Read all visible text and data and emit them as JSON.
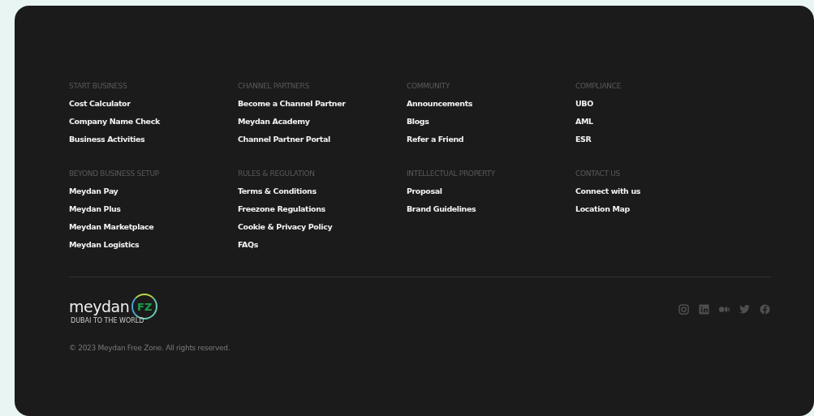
{
  "footer": {
    "columns": [
      {
        "sections": [
          {
            "heading": "START BUSINESS",
            "links": [
              "Cost Calculator",
              "Company Name Check",
              "Business Activities"
            ]
          },
          {
            "heading": "BEYOND BUSINESS SETUP",
            "links": [
              "Meydan Pay",
              "Meydan Plus",
              "Meydan Marketplace",
              "Meydan Logistics"
            ]
          }
        ]
      },
      {
        "sections": [
          {
            "heading": "CHANNEL PARTNERS",
            "links": [
              "Become a Channel Partner",
              "Meydan Academy",
              "Channel Partner Portal"
            ]
          },
          {
            "heading": "RULES & REGULATION",
            "links": [
              "Terms & Conditions",
              "Freezone Regulations",
              "Cookie & Privacy Policy",
              "FAQs"
            ]
          }
        ]
      },
      {
        "sections": [
          {
            "heading": "COMMUNITY",
            "links": [
              "Announcements",
              "Blogs",
              "Refer a Friend"
            ]
          },
          {
            "heading": "INTELLECTUAL PROPERTY",
            "links": [
              "Proposal",
              "Brand Guidelines"
            ]
          }
        ]
      },
      {
        "sections": [
          {
            "heading": "COMPLIANCE",
            "links": [
              "UBO",
              "AML",
              "ESR"
            ]
          },
          {
            "heading": "CONTACT US",
            "links": [
              "Connect with us",
              "Location Map"
            ]
          }
        ]
      }
    ],
    "logo": {
      "wordmark": "meydan",
      "badge": "FZ",
      "tagline": "DUBAI TO THE WORLD"
    },
    "copyright": "© 2023 Meydan Free Zone. All rights reserved.",
    "social": [
      {
        "kind": "instagram"
      },
      {
        "kind": "linkedin"
      },
      {
        "kind": "medium"
      },
      {
        "kind": "twitter"
      },
      {
        "kind": "facebook"
      }
    ]
  }
}
